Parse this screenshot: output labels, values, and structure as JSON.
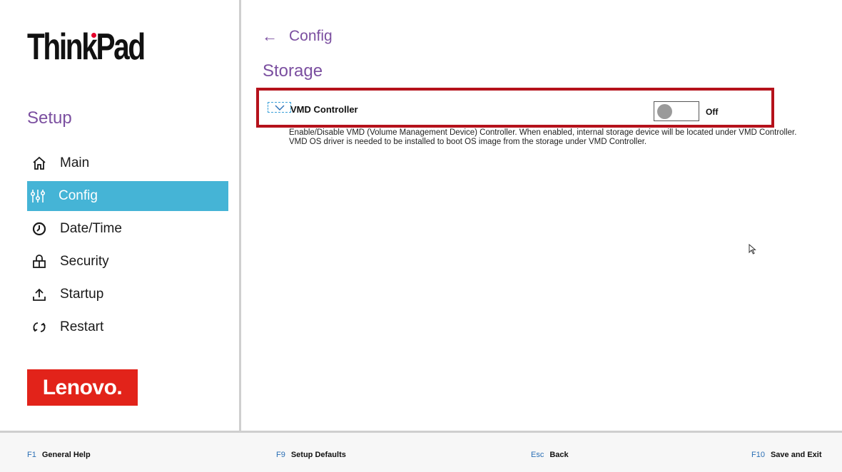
{
  "sidebar": {
    "brand": "ThinkPad",
    "section_title": "Setup",
    "items": [
      {
        "label": "Main",
        "icon": "home-icon"
      },
      {
        "label": "Config",
        "icon": "sliders-icon",
        "active": true
      },
      {
        "label": "Date/Time",
        "icon": "clock-icon"
      },
      {
        "label": "Security",
        "icon": "lock-icon"
      },
      {
        "label": "Startup",
        "icon": "upload-icon"
      },
      {
        "label": "Restart",
        "icon": "restart-icon"
      }
    ],
    "logo": "Lenovo."
  },
  "main": {
    "breadcrumb": "Config",
    "page_title": "Storage",
    "setting": {
      "label": "VMD Controller",
      "state": "Off",
      "description": "Enable/Disable VMD (Volume Management Device) Controller. When enabled, internal storage device will be located under VMD Controller. VMD OS driver is needed to be installed to boot OS image from the storage under VMD Controller."
    }
  },
  "footer": {
    "keys": [
      {
        "key": "F1",
        "label": "General Help"
      },
      {
        "key": "F9",
        "label": "Setup Defaults"
      },
      {
        "key": "Esc",
        "label": "Back"
      },
      {
        "key": "F10",
        "label": "Save and Exit"
      }
    ]
  },
  "colors": {
    "accent_purple": "#7b4fa0",
    "active_nav": "#45b4d6",
    "highlight_border": "#b5121b",
    "lenovo_red": "#e2231a"
  }
}
